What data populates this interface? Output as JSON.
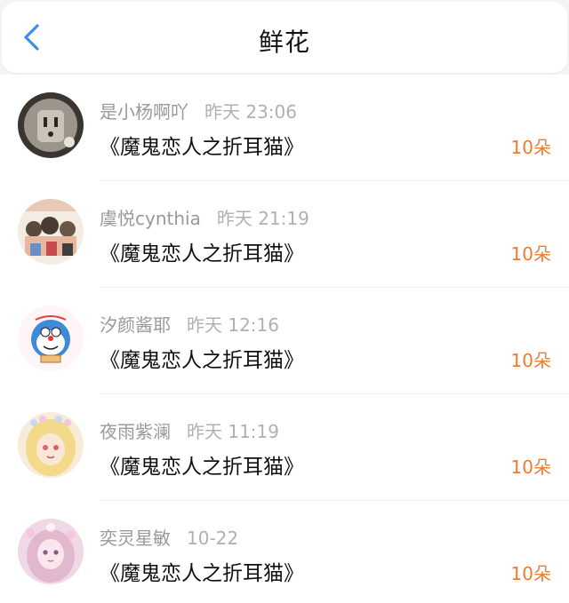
{
  "header": {
    "title": "鲜花",
    "back_icon": "chevron-left-icon",
    "accent_color": "#3b8fe8"
  },
  "colors": {
    "count": "#f07b28",
    "name": "#999999"
  },
  "list": [
    {
      "name": "是小杨啊吖",
      "time": "昨天 23:06",
      "book": "《魔鬼恋人之折耳猫》",
      "count": "10朵"
    },
    {
      "name": "虞悦cynthia",
      "time": "昨天 21:19",
      "book": "《魔鬼恋人之折耳猫》",
      "count": "10朵"
    },
    {
      "name": "汐颜酱耶",
      "time": "昨天 12:16",
      "book": "《魔鬼恋人之折耳猫》",
      "count": "10朵"
    },
    {
      "name": "夜雨紫澜",
      "time": "昨天 11:19",
      "book": "《魔鬼恋人之折耳猫》",
      "count": "10朵"
    },
    {
      "name": "奕灵星敏",
      "time": "10-22",
      "book": "《魔鬼恋人之折耳猫》",
      "count": "10朵"
    }
  ]
}
